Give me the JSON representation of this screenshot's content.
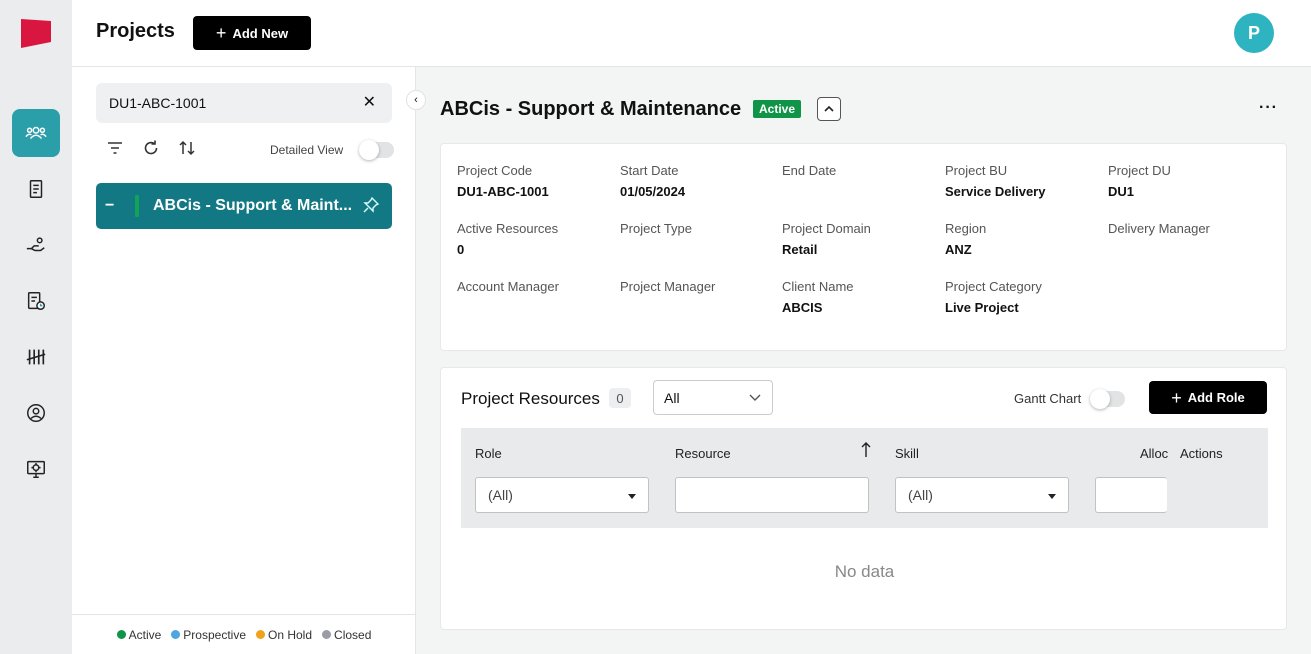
{
  "header": {
    "title": "Projects",
    "add_new_label": "Add New",
    "avatar_initial": "P"
  },
  "left_panel": {
    "search_value": "DU1-ABC-1001",
    "detailed_view_label": "Detailed View",
    "detailed_view_on": false,
    "project_item_name": "ABCis - Support & Maint...",
    "legend": [
      {
        "label": "Active",
        "color": "#109448"
      },
      {
        "label": "Prospective",
        "color": "#4ea6e0"
      },
      {
        "label": "On Hold",
        "color": "#f0a21a"
      },
      {
        "label": "Closed",
        "color": "#9a9ca8"
      }
    ]
  },
  "project": {
    "title": "ABCis - Support & Maintenance",
    "status": "Active",
    "status_color": "#109448",
    "fields": [
      {
        "label": "Project Code",
        "value": "DU1-ABC-1001"
      },
      {
        "label": "Start Date",
        "value": "01/05/2024"
      },
      {
        "label": "End Date",
        "value": ""
      },
      {
        "label": "Project BU",
        "value": "Service Delivery"
      },
      {
        "label": "Project DU",
        "value": "DU1"
      },
      {
        "label": "Active Resources",
        "value": "0"
      },
      {
        "label": "Project Type",
        "value": ""
      },
      {
        "label": "Project Domain",
        "value": "Retail"
      },
      {
        "label": "Region",
        "value": "ANZ"
      },
      {
        "label": "Delivery Manager",
        "value": ""
      },
      {
        "label": "Account Manager",
        "value": ""
      },
      {
        "label": "Project Manager",
        "value": ""
      },
      {
        "label": "Client Name",
        "value": "ABCIS"
      },
      {
        "label": "Project Category",
        "value": "Live Project"
      }
    ]
  },
  "resources": {
    "title": "Project Resources",
    "count": "0",
    "filter_value": "All",
    "gantt_label": "Gantt Chart",
    "gantt_on": false,
    "add_role_label": "Add Role",
    "columns": {
      "role": "Role",
      "resource": "Resource",
      "skill": "Skill",
      "allocation": "Alloc",
      "actions": "Actions"
    },
    "role_filter": "(All)",
    "skill_filter": "(All)",
    "empty_text": "No data"
  },
  "colors": {
    "accent": "#2a9ea9",
    "selected_project": "#127883",
    "brand": "#d9163f"
  }
}
